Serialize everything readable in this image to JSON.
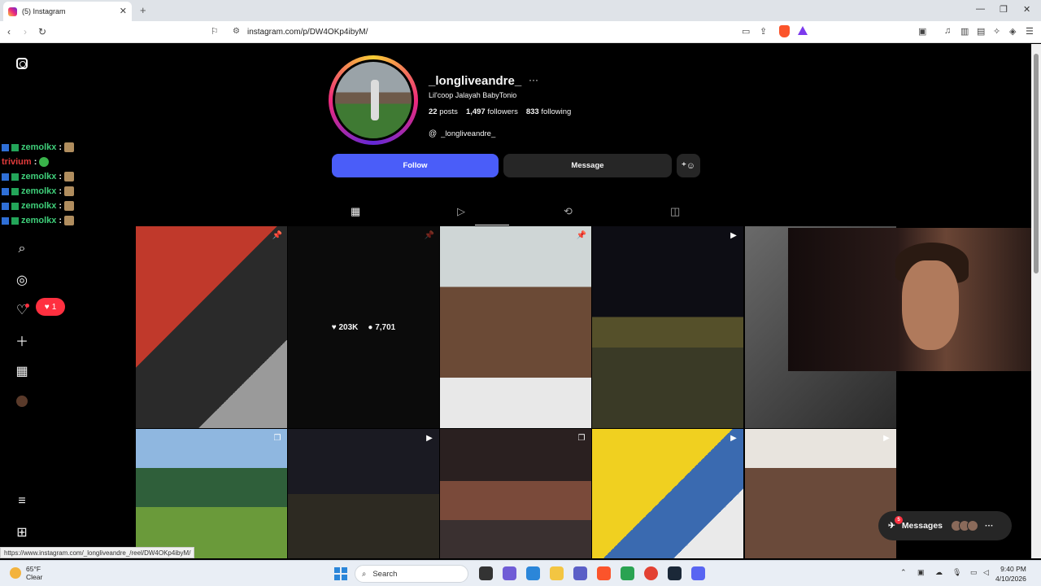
{
  "browser": {
    "tab_title": "(5) Instagram",
    "tab_close": "✕",
    "new_tab": "+",
    "url": "instagram.com/p/DW4OKp4ibyM/",
    "window_controls": [
      "—",
      "❐",
      "✕"
    ]
  },
  "profile": {
    "username": "_longliveandre_",
    "more": "···",
    "full_name": "Lil'coop Jalayah BabyTonio",
    "posts_count": "22",
    "posts_label": "posts",
    "followers_count": "1,497",
    "followers_label": "followers",
    "following_count": "833",
    "following_label": "following",
    "threads_handle": "_longliveandre_",
    "follow_label": "Follow",
    "message_label": "Message"
  },
  "chat": [
    {
      "name": "zemolkx",
      "sep": ":"
    },
    {
      "name": "trivium",
      "sep": ":"
    },
    {
      "name": "zemolkx",
      "sep": ":"
    },
    {
      "name": "zemolkx",
      "sep": ":"
    },
    {
      "name": "zemolkx",
      "sep": ":"
    },
    {
      "name": "zemolkx",
      "sep": ":"
    }
  ],
  "notifications": {
    "count": "1",
    "heart": "♥"
  },
  "grid": {
    "hover_likes": "203K",
    "hover_comments": "7,701"
  },
  "messages": {
    "label": "Messages",
    "badge": "5",
    "more": "···"
  },
  "status_url": "https://www.instagram.com/_longliveandre_/reel/DW4OKp4ibyM/",
  "taskbar": {
    "temp": "65°F",
    "condition": "Clear",
    "search": "Search",
    "time": "9:40 PM",
    "date": "4/10/2026"
  },
  "colors": {
    "follow": "#4a5df9",
    "notification": "#ff3040",
    "chat_name": "#3fcf7a"
  }
}
